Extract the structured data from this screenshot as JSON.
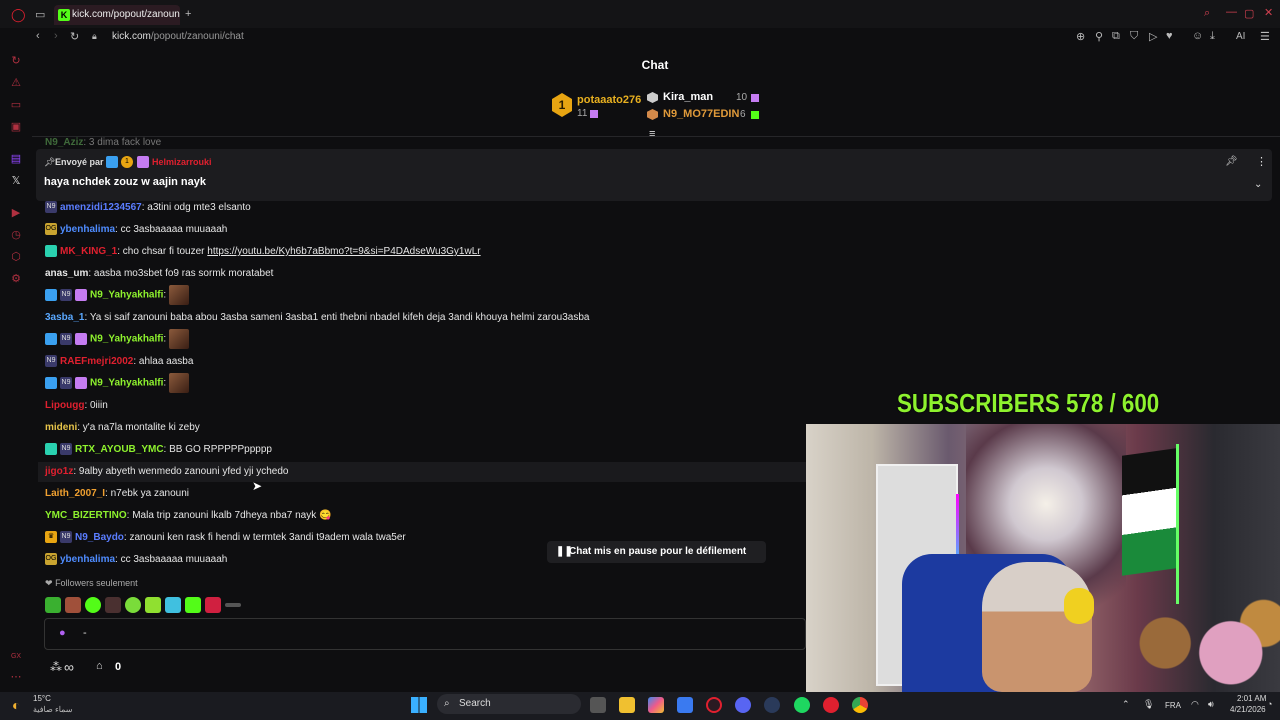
{
  "browser": {
    "tab_title": "kick.com/popout/zanouni/",
    "tab_logo": "K",
    "url_host": "kick.com",
    "url_path": "/popout/zanouni/chat",
    "ai_label": "AI"
  },
  "chat": {
    "title": "Chat",
    "leaderboard": {
      "first": {
        "rank": "1",
        "name": "potaaato276",
        "count": "11"
      },
      "second": {
        "name": "Kira_man",
        "count": "10"
      },
      "third": {
        "name": "N9_MO77EDIN",
        "count": "6"
      }
    },
    "pinned": {
      "sent_by": "Envoyé par",
      "sender": "Helmizarrouki",
      "text": "haya nchdek zouz w aajin nayk"
    },
    "partial_top": {
      "user": "N9_Aziz",
      "text": ": 3 dima fack love"
    },
    "messages": [
      {
        "user": "amenzidi1234567",
        "color": "#5a7dff",
        "text": ": a3tini odg mte3 elsanto"
      },
      {
        "user": "ybenhalima",
        "color": "#4f8cff",
        "text": ": cc 3asbaaaaa muuaaah"
      },
      {
        "user": "MK_KING_1",
        "color": "#e0202f",
        "text": ": cho chsar fi touzer ",
        "link": "https://youtu.be/Kyh6b7aBbmo?t=9&si=P4DAdseWu3Gy1wLr"
      },
      {
        "user": "anas_um",
        "color": "#e6e6e6",
        "text": ": aasba mo3sbet fo9 ras sormk moratabet"
      },
      {
        "user": "N9_Yahyakhalfi",
        "color": "#8ef22e",
        "text": ":"
      },
      {
        "user": "3asba_1",
        "color": "#5aa8ff",
        "text": ": Ya si saif zanouni baba abou 3asba sameni 3asba1 enti thebni nbadel kifeh deja 3andi khouya helmi zarou3asba"
      },
      {
        "user": "N9_Yahyakhalfi",
        "color": "#8ef22e",
        "text": ":"
      },
      {
        "user": "RAEFmejri2002",
        "color": "#e0202f",
        "text": ": ahlaa aasba"
      },
      {
        "user": "N9_Yahyakhalfi",
        "color": "#8ef22e",
        "text": ":"
      },
      {
        "user": "Lipougg",
        "color": "#e0202f",
        "text": ": 0iiin"
      },
      {
        "user": "mideni",
        "color": "#e6c44a",
        "text": ": y'a na7la montalite ki zeby"
      },
      {
        "user": "RTX_AYOUB_YMC",
        "color": "#8ef22e",
        "text": ": BB GO RPPPPPppppp"
      },
      {
        "user": "jigo1z",
        "color": "#e0202f",
        "text": ": 9alby abyeth wenmedo zanouni yfed yji ychedo"
      },
      {
        "user": "Laith_2007_I",
        "color": "#f0a030",
        "text": ": n7ebk ya zanouni"
      },
      {
        "user": "YMC_BIZERTINO",
        "color": "#8ef22e",
        "text": ": Mala trip zanouni lkalb 7dheya nba7 nayk 😋"
      },
      {
        "user": "N9_Baydo",
        "color": "#5a7dff",
        "text": ": zanouni ken rask fi hendi w termtek 3andi t9adem wala twa5er"
      },
      {
        "user": "ybenhalima",
        "color": "#4f8cff",
        "text": ": cc 3asbaaaaa muuaaah"
      }
    ],
    "paused_label": "Chat mis en pause pour le défilement",
    "followers_only": "Followers seulement",
    "input_placeholder": "-",
    "points_value": "∞",
    "gift_count": "0"
  },
  "stream_overlay": {
    "subscribers_text": "SUBSCRIBERS 578 / 600"
  },
  "taskbar": {
    "weather_temp": "15°C",
    "weather_desc": "سماء صافية",
    "search_label": "Search",
    "language": "FRA",
    "time": "2:01 AM",
    "date": "4/21/2026"
  }
}
